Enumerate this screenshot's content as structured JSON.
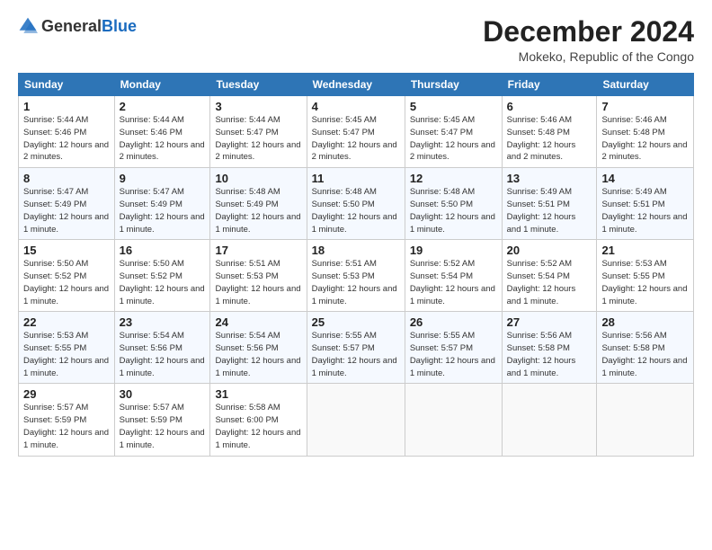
{
  "logo": {
    "general": "General",
    "blue": "Blue"
  },
  "title": "December 2024",
  "subtitle": "Mokeko, Republic of the Congo",
  "headers": [
    "Sunday",
    "Monday",
    "Tuesday",
    "Wednesday",
    "Thursday",
    "Friday",
    "Saturday"
  ],
  "weeks": [
    [
      {
        "day": "1",
        "sunrise": "5:44 AM",
        "sunset": "5:46 PM",
        "daylight": "12 hours and 2 minutes."
      },
      {
        "day": "2",
        "sunrise": "5:44 AM",
        "sunset": "5:46 PM",
        "daylight": "12 hours and 2 minutes."
      },
      {
        "day": "3",
        "sunrise": "5:44 AM",
        "sunset": "5:47 PM",
        "daylight": "12 hours and 2 minutes."
      },
      {
        "day": "4",
        "sunrise": "5:45 AM",
        "sunset": "5:47 PM",
        "daylight": "12 hours and 2 minutes."
      },
      {
        "day": "5",
        "sunrise": "5:45 AM",
        "sunset": "5:47 PM",
        "daylight": "12 hours and 2 minutes."
      },
      {
        "day": "6",
        "sunrise": "5:46 AM",
        "sunset": "5:48 PM",
        "daylight": "12 hours and 2 minutes."
      },
      {
        "day": "7",
        "sunrise": "5:46 AM",
        "sunset": "5:48 PM",
        "daylight": "12 hours and 2 minutes."
      }
    ],
    [
      {
        "day": "8",
        "sunrise": "5:47 AM",
        "sunset": "5:49 PM",
        "daylight": "12 hours and 1 minute."
      },
      {
        "day": "9",
        "sunrise": "5:47 AM",
        "sunset": "5:49 PM",
        "daylight": "12 hours and 1 minute."
      },
      {
        "day": "10",
        "sunrise": "5:48 AM",
        "sunset": "5:49 PM",
        "daylight": "12 hours and 1 minute."
      },
      {
        "day": "11",
        "sunrise": "5:48 AM",
        "sunset": "5:50 PM",
        "daylight": "12 hours and 1 minute."
      },
      {
        "day": "12",
        "sunrise": "5:48 AM",
        "sunset": "5:50 PM",
        "daylight": "12 hours and 1 minute."
      },
      {
        "day": "13",
        "sunrise": "5:49 AM",
        "sunset": "5:51 PM",
        "daylight": "12 hours and 1 minute."
      },
      {
        "day": "14",
        "sunrise": "5:49 AM",
        "sunset": "5:51 PM",
        "daylight": "12 hours and 1 minute."
      }
    ],
    [
      {
        "day": "15",
        "sunrise": "5:50 AM",
        "sunset": "5:52 PM",
        "daylight": "12 hours and 1 minute."
      },
      {
        "day": "16",
        "sunrise": "5:50 AM",
        "sunset": "5:52 PM",
        "daylight": "12 hours and 1 minute."
      },
      {
        "day": "17",
        "sunrise": "5:51 AM",
        "sunset": "5:53 PM",
        "daylight": "12 hours and 1 minute."
      },
      {
        "day": "18",
        "sunrise": "5:51 AM",
        "sunset": "5:53 PM",
        "daylight": "12 hours and 1 minute."
      },
      {
        "day": "19",
        "sunrise": "5:52 AM",
        "sunset": "5:54 PM",
        "daylight": "12 hours and 1 minute."
      },
      {
        "day": "20",
        "sunrise": "5:52 AM",
        "sunset": "5:54 PM",
        "daylight": "12 hours and 1 minute."
      },
      {
        "day": "21",
        "sunrise": "5:53 AM",
        "sunset": "5:55 PM",
        "daylight": "12 hours and 1 minute."
      }
    ],
    [
      {
        "day": "22",
        "sunrise": "5:53 AM",
        "sunset": "5:55 PM",
        "daylight": "12 hours and 1 minute."
      },
      {
        "day": "23",
        "sunrise": "5:54 AM",
        "sunset": "5:56 PM",
        "daylight": "12 hours and 1 minute."
      },
      {
        "day": "24",
        "sunrise": "5:54 AM",
        "sunset": "5:56 PM",
        "daylight": "12 hours and 1 minute."
      },
      {
        "day": "25",
        "sunrise": "5:55 AM",
        "sunset": "5:57 PM",
        "daylight": "12 hours and 1 minute."
      },
      {
        "day": "26",
        "sunrise": "5:55 AM",
        "sunset": "5:57 PM",
        "daylight": "12 hours and 1 minute."
      },
      {
        "day": "27",
        "sunrise": "5:56 AM",
        "sunset": "5:58 PM",
        "daylight": "12 hours and 1 minute."
      },
      {
        "day": "28",
        "sunrise": "5:56 AM",
        "sunset": "5:58 PM",
        "daylight": "12 hours and 1 minute."
      }
    ],
    [
      {
        "day": "29",
        "sunrise": "5:57 AM",
        "sunset": "5:59 PM",
        "daylight": "12 hours and 1 minute."
      },
      {
        "day": "30",
        "sunrise": "5:57 AM",
        "sunset": "5:59 PM",
        "daylight": "12 hours and 1 minute."
      },
      {
        "day": "31",
        "sunrise": "5:58 AM",
        "sunset": "6:00 PM",
        "daylight": "12 hours and 1 minute."
      },
      null,
      null,
      null,
      null
    ]
  ]
}
